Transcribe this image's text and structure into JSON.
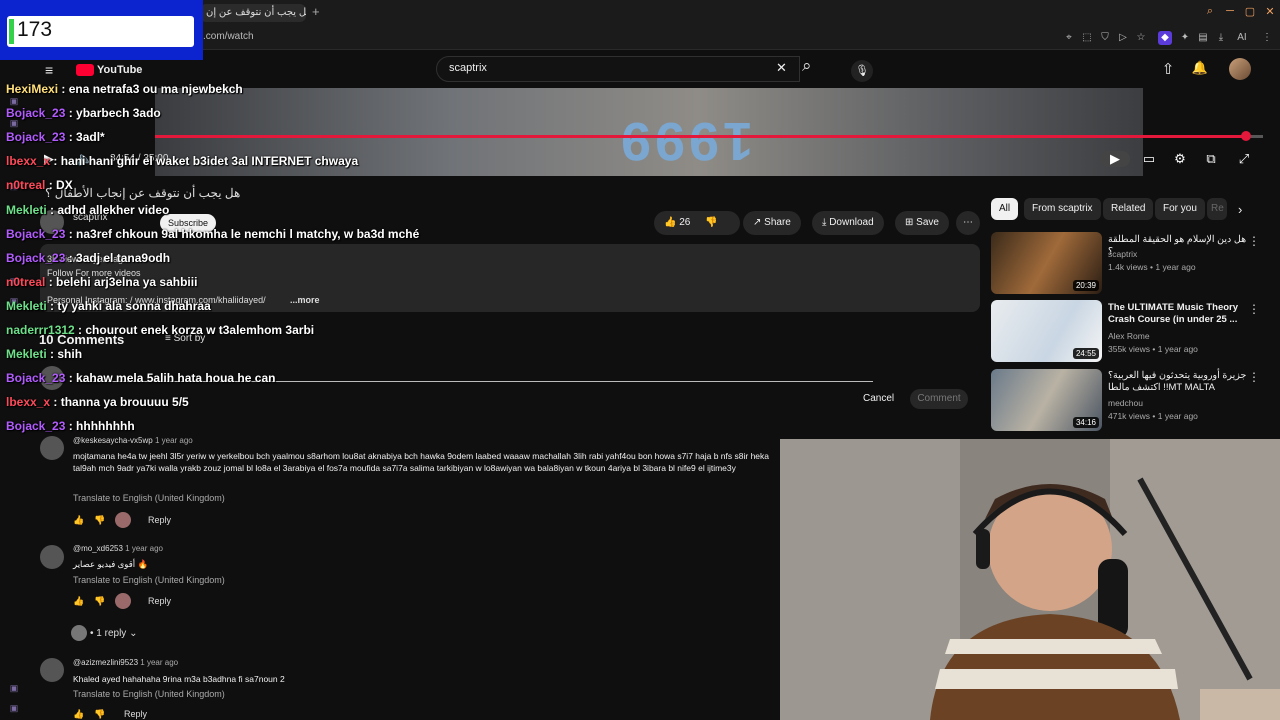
{
  "counter": {
    "value": "173"
  },
  "browser": {
    "tab_title": "هل يجب أن نتوقف عن إن...",
    "new_tab": "+",
    "url": ".com/watch",
    "ext_ai": "AI"
  },
  "header": {
    "logo_text": "YouTube",
    "search_value": "scaptrix",
    "clear_glyph": "✕",
    "search_glyph": "⌕",
    "mic_glyph": "🎙",
    "upload_glyph": "⇧",
    "bell_glyph": "🔔"
  },
  "video": {
    "art_text": "1999",
    "time": "34:54 / 35:00",
    "progress": 0.985
  },
  "info": {
    "title": "هل يجب أن نتوقف عن إنجاب الأطفال ؟",
    "channel": "scaptrix",
    "subscribe": "Subscribe",
    "likes": "26",
    "share": "Share",
    "download": "Download",
    "save": "Save",
    "desc_views": "3K views  1 year ago",
    "desc_line1": "Follow For more videos",
    "desc_line2": "Personal Instagram:  / www.instagram.com/khaliidayed/",
    "desc_more": "...more"
  },
  "comments": {
    "count": "10 Comments",
    "sort_by": "Sort by",
    "cancel": "Cancel",
    "comment_btn": "Comment",
    "translate": "Translate to English (United Kingdom)",
    "reply": "Reply",
    "items": [
      {
        "handle": "@keskesaycha-vx5wp",
        "age": "1 year ago",
        "text": "mojtamana he4a tw jeehl 3l5r yeriw w yerkelbou bch yaalmou s8arhom lou8at aknabiya bch hawka 9odem laabed waaaw machallah 3lih rabi yahf4ou bon howa s7i7 haja b nfs s8ir heka tal9ah mch 9adr ya7ki walla yrakb zouz jomal bl lo8a el 3arabiya el fos7a moufida  sa7i7a salima  tarkibiyan w lo8awiyan wa bala8iyan  w tkoun 4ariya bl 3ibara bl nife9 el ijtime3y"
      },
      {
        "handle": "@mo_xd6253",
        "age": "1 year ago",
        "text": "أقوى فيديو عصاير 🔥",
        "replies": "1 reply"
      },
      {
        "handle": "@azizmezlini9523",
        "age": "1 year ago",
        "text": "Khaled ayed hahahaha 9rina m3a b3adhna fi sa7noun 2"
      }
    ]
  },
  "sidebar": {
    "chips": [
      "All",
      "From scaptrix",
      "Related",
      "For you",
      "Re"
    ],
    "videos": [
      {
        "title": "هل دين الإسلام هو الحقيقة المطلقة ؟",
        "channel": "scaptrix",
        "meta": "1.4k views • 1 year ago",
        "duration": "20:39"
      },
      {
        "title": "The ULTIMATE Music Theory Crash Course (in under 25 ...",
        "channel": "Alex Rome",
        "meta": "355k views • 1 year ago",
        "duration": "24:55"
      },
      {
        "title": "جزيرة أوروبية يتحدثون فيها العربية؟ اكتشف مالطا !!MT MALTA",
        "channel": "medchou",
        "meta": "471k views • 1 year ago",
        "duration": "34:16"
      }
    ]
  },
  "chat": [
    {
      "user": "HexiMexi",
      "msg": " : ena netrafa3 ou ma njewbekch",
      "color": "yellow"
    },
    {
      "user": "Bojack_23",
      "msg": " : ybarbech 3ado",
      "color": "purple"
    },
    {
      "user": "Bojack_23",
      "msg": " : 3adl*",
      "color": "purple"
    },
    {
      "user": "lbexx_x",
      "msg": " : hani hani ghir el waket b3idet 3al INTERNET chwaya",
      "color": "red"
    },
    {
      "user": "n0treal",
      "msg": " : DX",
      "color": "red"
    },
    {
      "user": "Mekleti",
      "msg": " : adhd allekher video",
      "color": "green"
    },
    {
      "user": "Bojack_23",
      "msg": " : na3ref chkoun 9al hkomha le nemchi l matchy, w ba3d mché",
      "color": "purple"
    },
    {
      "user": "Bojack_23",
      "msg": " : 3adj el tana9odh",
      "color": "purple"
    },
    {
      "user": "n0treal",
      "msg": " : belehi arj3elna ya sahbiii",
      "color": "red"
    },
    {
      "user": "Mekleti",
      "msg": " : ty yahki ala sonna dhahraa",
      "color": "green"
    },
    {
      "user": "naderrr1312",
      "msg": " : chourout enek korza w t3alemhom 3arbi",
      "color": "green"
    },
    {
      "user": "Mekleti",
      "msg": " : shih",
      "color": "green"
    },
    {
      "user": "Bojack_23",
      "msg": " : kahaw mela 5alih hata houa he can",
      "color": "purple"
    },
    {
      "user": "lbexx_x",
      "msg": " : thanna ya brouuuu 5/5",
      "color": "red"
    },
    {
      "user": "Bojack_23",
      "msg": " : hhhhhhhh",
      "color": "purple"
    }
  ]
}
